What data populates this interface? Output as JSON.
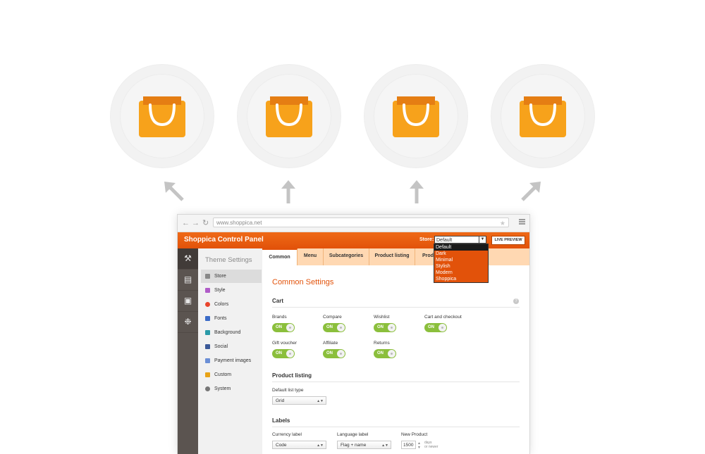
{
  "colors": {
    "accent": "#e2520a",
    "bag": "#f7a21b",
    "bag_dark": "#e57e13",
    "toggle_on": "#8bbf3c"
  },
  "bags": [
    {
      "icon": "shopping-bag-icon"
    },
    {
      "icon": "shopping-bag-icon"
    },
    {
      "icon": "shopping-bag-icon"
    },
    {
      "icon": "shopping-bag-icon"
    }
  ],
  "browser": {
    "url": "www.shoppica.net"
  },
  "header": {
    "title": "Shoppica Control Panel",
    "store_label": "Store:",
    "store_value": "Default",
    "live_preview": "LIVE PREVIEW",
    "store_options": [
      "Default",
      "Dark",
      "Minimal",
      "Stylish",
      "Modern",
      "Shoppica"
    ]
  },
  "sidebar": {
    "title": "Theme Settings",
    "items": [
      {
        "label": "Store"
      },
      {
        "label": "Style"
      },
      {
        "label": "Colors"
      },
      {
        "label": "Fonts"
      },
      {
        "label": "Background"
      },
      {
        "label": "Social"
      },
      {
        "label": "Payment images"
      },
      {
        "label": "Custom"
      },
      {
        "label": "System"
      }
    ]
  },
  "tabs": [
    "Common",
    "Menu",
    "Subcategories",
    "Product listing",
    "Prod"
  ],
  "content": {
    "title": "Common Settings",
    "cart": {
      "heading": "Cart",
      "toggles": [
        {
          "label": "Brands",
          "state": "ON"
        },
        {
          "label": "Compare",
          "state": "ON"
        },
        {
          "label": "Wishlist",
          "state": "ON"
        },
        {
          "label": "Cart and checkout",
          "state": "ON"
        },
        {
          "label": "Gift voucher",
          "state": "ON"
        },
        {
          "label": "Affiliate",
          "state": "ON"
        },
        {
          "label": "Returns",
          "state": "ON"
        }
      ]
    },
    "product_listing": {
      "heading": "Product listing",
      "list_type_label": "Default list type",
      "list_type_value": "Grid"
    },
    "labels": {
      "heading": "Labels",
      "currency_label": "Currency label",
      "currency_value": "Code",
      "language_label": "Language label",
      "language_value": "Flag + name",
      "new_product_label": "New Product",
      "new_product_value": "1500",
      "days_text": "days",
      "newer_text": "or newer"
    }
  }
}
